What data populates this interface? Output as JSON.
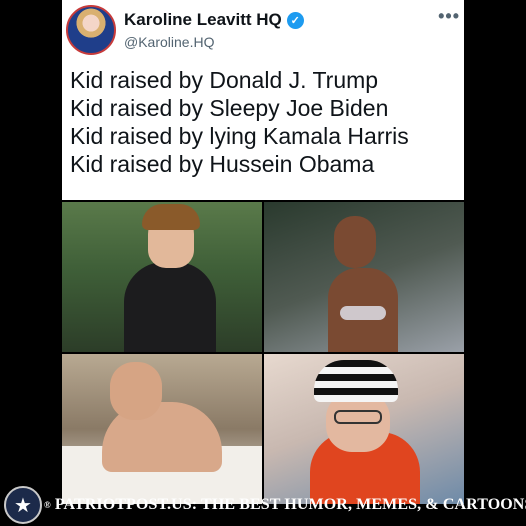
{
  "post": {
    "author_name": "Karoline Leavitt HQ",
    "handle": "@Karoline.HQ",
    "verified_icon": "verified-badge-icon",
    "more_icon": "more-options-icon",
    "text_lines": [
      "Kid raised by Donald J. Trump",
      "Kid raised by Sleepy Joe Biden",
      "Kid raised by lying Kamala Harris",
      "Kid raised by Hussein Obama"
    ]
  },
  "photos": [
    {
      "subject": "young man in dark suit"
    },
    {
      "subject": "woman in bikini smoking"
    },
    {
      "subject": "man in bathtub with cigarette"
    },
    {
      "subject": "person in striped hat and orange top"
    }
  ],
  "footer": {
    "badge_icon": "star-seal-icon",
    "registered_mark": "®",
    "text": "PATRIOTPOST.US: THE BEST HUMOR, MEMES, & CARTOONS"
  },
  "colors": {
    "background": "#000000",
    "card": "#ffffff",
    "verified": "#1d9bf0",
    "footer_text": "#ffffff"
  }
}
